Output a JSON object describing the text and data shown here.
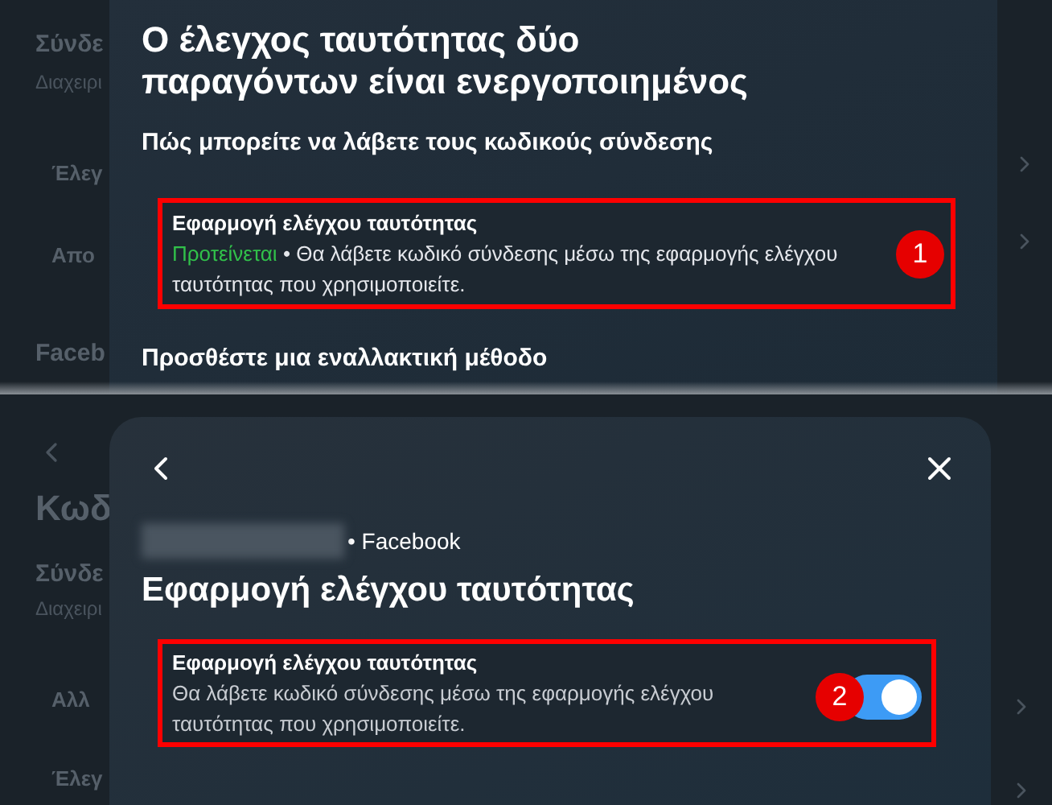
{
  "top_screen": {
    "background": {
      "section_title": "Σύνδε",
      "section_subtitle": "Διαχειρι",
      "items": [
        "Έλεγ",
        "Απο"
      ],
      "next_section": "Faceb"
    },
    "dialog": {
      "title": "Ο έλεγχος ταυτότητας δύο παραγόντων είναι ενεργοποιημένος",
      "subtitle": "Πώς μπορείτε να λάβετε τους κωδικούς σύνδεσης",
      "method": {
        "label": "Εφαρμογή ελέγχου ταυτότητας",
        "tag": "Προτείνεται",
        "description": "• Θα λάβετε κωδικό σύνδεσης μέσω της εφαρμογής ελέγχου ταυτότητας που χρησιμοποιείτε."
      },
      "annotation": "1",
      "section_heading": "Προσθέστε μια εναλλακτική μέθοδο"
    }
  },
  "bottom_screen": {
    "background": {
      "page_title": "Κωδ",
      "section_title": "Σύνδε",
      "section_subtitle": "Διαχειρι",
      "items": [
        "Αλλ",
        "Έλεγ"
      ]
    },
    "dialog": {
      "account": "• Facebook",
      "title": "Εφαρμογή ελέγχου ταυτότητας",
      "setting": {
        "label": "Εφαρμογή ελέγχου ταυτότητας",
        "description": "Θα λάβετε κωδικό σύνδεσης μέσω της εφαρμογής ελέγχου ταυτότητας που χρησιμοποιείτε.",
        "on": true
      },
      "annotation": "2"
    }
  }
}
